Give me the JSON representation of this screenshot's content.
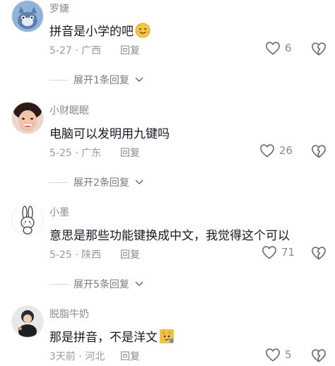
{
  "comments": [
    {
      "username": "罗婕",
      "text": "拼音是小学的吧",
      "date": "5-27",
      "location": "广西",
      "reply_label": "回复",
      "likes": "6",
      "expand_label": "展开1条回复",
      "emoji": "smiling-face"
    },
    {
      "username": "小财眠眠",
      "text": "电脑可以发明用九键吗",
      "date": "5-25",
      "location": "广东",
      "reply_label": "回复",
      "likes": "26",
      "expand_label": "展开2条回复"
    },
    {
      "username": "小墨",
      "text": "意思是那些功能键换成中文，我觉得这个可以",
      "date": "5-25",
      "location": "陕西",
      "reply_label": "回复",
      "likes": "71",
      "expand_label": "展开5条回复"
    },
    {
      "username": "脱脂牛奶",
      "text": "那是拼音，不是洋文",
      "date": "3天前",
      "location": "河北",
      "reply_label": "回复",
      "likes": "5",
      "emoji": "cat-sticker"
    }
  ],
  "colors": {
    "text": "#161823",
    "muted": "#8a8a8a",
    "emoji_yellow": "#f5c842"
  }
}
